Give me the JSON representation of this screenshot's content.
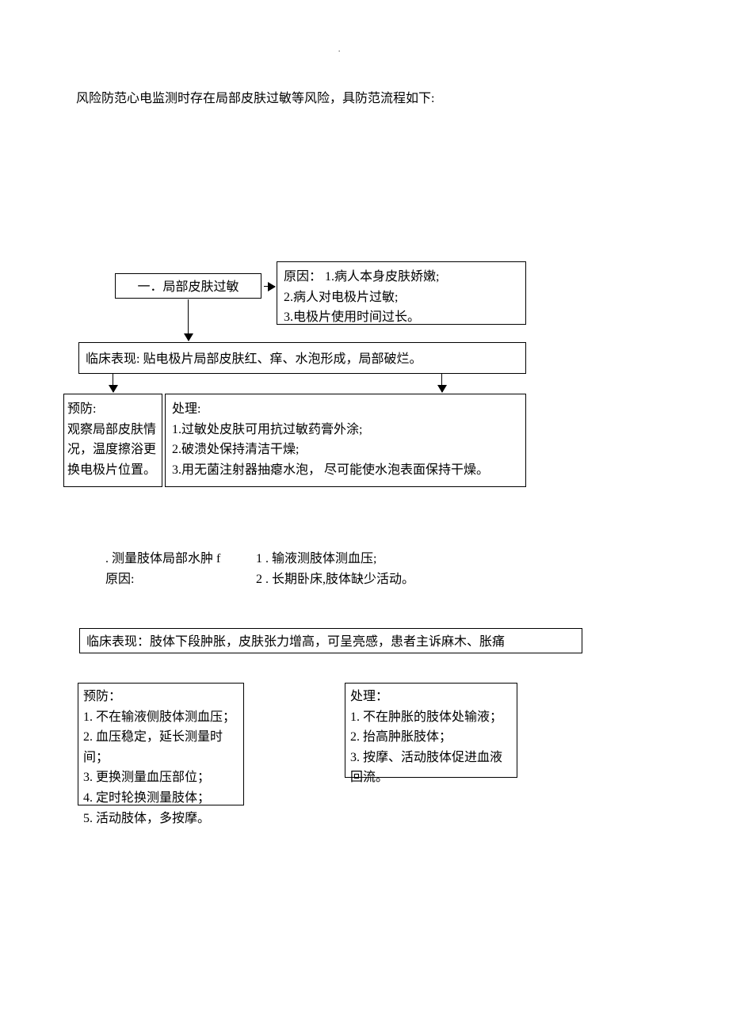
{
  "intro": "风险防范心电监测时存在局部皮肤过敏等风险，具防范流程如下:",
  "dot": ".",
  "box1": "一．局部皮肤过敏",
  "box2": {
    "l1": "原因：  1.病人本身皮肤娇嫩;",
    "l2": "2.病人对电极片过敏;",
    "l3": "3.电极片使用时间过长。"
  },
  "box3": "临床表现:   贴电极片局部皮肤红、痒、水泡形成，局部破烂。",
  "box4": {
    "l1": "预防:",
    "l2": "观察局部皮肤情况，温度擦浴更换电极片位置。"
  },
  "box5": {
    "l1": "处理:",
    "l2": "1.过敏处皮肤可用抗过敏药膏外涂;",
    "l3": "2.破溃处保持清洁干燥;",
    "l4": "3.用无菌注射器抽瘪水泡，   尽可能使水泡表面保持干燥。"
  },
  "text6": {
    "l1": ". 测量肢体局部水肿 f",
    "l2": "原因:"
  },
  "text7": {
    "l1": "1  .  输液测肢体测血压;",
    "l2": "2   .   长期卧床,肢体缺少活动。"
  },
  "box8": "临床表现：肢体下段肿胀，皮肤张力增高，可呈亮感，患者主诉麻木、胀痛",
  "box9": {
    "l1": "预防：",
    "l2": "1. 不在输液侧肢体测血压；",
    "l3": "2. 血压稳定，延长测量时间；",
    "l4": "3. 更换测量血压部位；",
    "l5": "4. 定时轮换测量肢体；",
    "l6": "5. 活动肢体，多按摩。"
  },
  "box10": {
    "l1": "处理：",
    "l2": "1. 不在肿胀的肢体处输液；",
    "l3": "2. 抬高肿胀肢体；",
    "l4": "3. 按摩、活动肢体促进血液回流。"
  }
}
